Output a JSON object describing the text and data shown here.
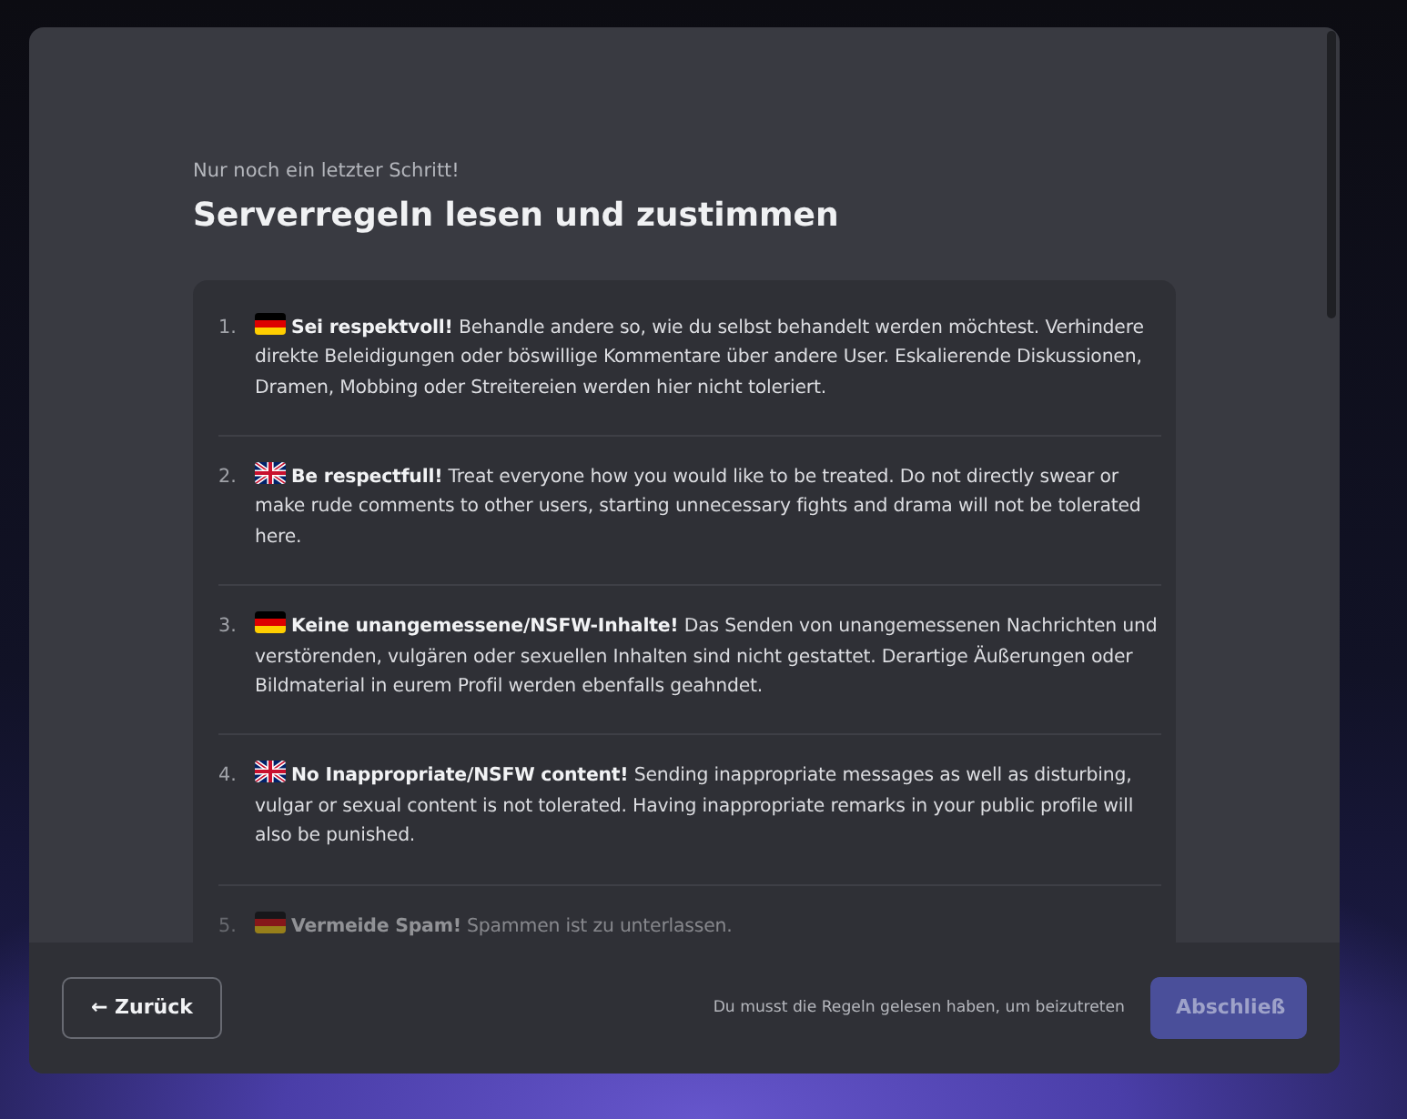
{
  "modal": {
    "eyebrow": "Nur noch ein letzter Schritt!",
    "title": "Serverregeln lesen und zustimmen",
    "rules": [
      {
        "number": "1.",
        "kind": "de",
        "title": "Sei respektvoll!",
        "text": "Behandle andere so, wie du selbst behandelt werden möchtest. Verhindere direkte Beleidigungen oder böswillige Kommentare über andere User. Eskalierende Diskussionen, Dramen, Mobbing oder Streitereien werden hier nicht toleriert.",
        "faded": false
      },
      {
        "number": "2.",
        "kind": "gb",
        "title": "Be respectfull!",
        "text": "Treat everyone how you would like to be treated. Do not directly swear or make rude comments to other users, starting unnecessary fights and drama will not be tolerated here.",
        "faded": false
      },
      {
        "number": "3.",
        "kind": "de",
        "title": "Keine unangemessene/NSFW-Inhalte!",
        "text": "Das Senden von unangemessenen Nachrichten und verstörenden, vulgären oder sexuellen Inhalten sind nicht gestattet. Derartige Äußerungen oder Bildmaterial in eurem Profil werden ebenfalls geahndet.",
        "faded": false
      },
      {
        "number": "4.",
        "kind": "gb",
        "title": "No Inappropriate/NSFW content!",
        "text": "Sending inappropriate messages as well as disturbing, vulgar or sexual content is not tolerated. Having inappropriate remarks in your public profile will also be punished.",
        "faded": false
      },
      {
        "number": "5.",
        "kind": "de",
        "title": "Vermeide Spam!",
        "text": "Spammen ist zu unterlassen.",
        "faded": true
      }
    ],
    "footer": {
      "back_button": "← Zurück",
      "hint": "Du musst die Regeln gelesen haben, um beizutreten",
      "finish_button": {
        "label": "Abschließ",
        "disabled": true
      }
    }
  }
}
